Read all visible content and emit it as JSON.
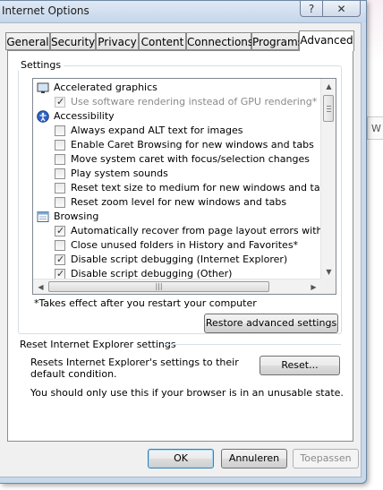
{
  "window": {
    "title": "Internet Options",
    "help_glyph": "?",
    "close_glyph": "✕"
  },
  "background": {
    "partial_text": "W"
  },
  "tabs": [
    {
      "label": "General",
      "active": false
    },
    {
      "label": "Security",
      "active": false
    },
    {
      "label": "Privacy",
      "active": false
    },
    {
      "label": "Content",
      "active": false
    },
    {
      "label": "Connections",
      "active": false
    },
    {
      "label": "Programs",
      "active": false
    },
    {
      "label": "Advanced",
      "active": true
    }
  ],
  "settings": {
    "group_label": "Settings",
    "rows": [
      {
        "type": "category",
        "icon": "monitor-icon",
        "label": "Accelerated graphics"
      },
      {
        "type": "option",
        "checked": true,
        "disabled": true,
        "label": "Use software rendering instead of GPU rendering*"
      },
      {
        "type": "category",
        "icon": "accessibility-icon",
        "label": "Accessibility"
      },
      {
        "type": "option",
        "checked": false,
        "disabled": false,
        "label": "Always expand ALT text for images"
      },
      {
        "type": "option",
        "checked": false,
        "disabled": false,
        "label": "Enable Caret Browsing for new windows and tabs"
      },
      {
        "type": "option",
        "checked": false,
        "disabled": false,
        "label": "Move system caret with focus/selection changes"
      },
      {
        "type": "option",
        "checked": false,
        "disabled": false,
        "label": "Play system sounds"
      },
      {
        "type": "option",
        "checked": false,
        "disabled": false,
        "label": "Reset text size to medium for new windows and tabs"
      },
      {
        "type": "option",
        "checked": false,
        "disabled": false,
        "label": "Reset zoom level for new windows and tabs"
      },
      {
        "type": "category",
        "icon": "browsing-icon",
        "label": "Browsing"
      },
      {
        "type": "option",
        "checked": true,
        "disabled": false,
        "label": "Automatically recover from page layout errors with Compa"
      },
      {
        "type": "option",
        "checked": false,
        "disabled": false,
        "label": "Close unused folders in History and Favorites*"
      },
      {
        "type": "option",
        "checked": true,
        "disabled": false,
        "label": "Disable script debugging (Internet Explorer)"
      },
      {
        "type": "option",
        "checked": true,
        "disabled": false,
        "label": "Disable script debugging (Other)"
      }
    ],
    "note": "*Takes effect after you restart your computer",
    "restore_button": "Restore advanced settings"
  },
  "reset": {
    "section_title": "Reset Internet Explorer settings",
    "description": "Resets Internet Explorer's settings to their default condition.",
    "button": "Reset...",
    "warning": "You should only use this if your browser is in an unusable state."
  },
  "footer": {
    "ok": "OK",
    "cancel": "Annuleren",
    "apply": "Toepassen"
  },
  "colors": {
    "frame": "#c9d9ea",
    "panel": "#f0f0f0",
    "default_button_border": "#3c7fb1"
  }
}
